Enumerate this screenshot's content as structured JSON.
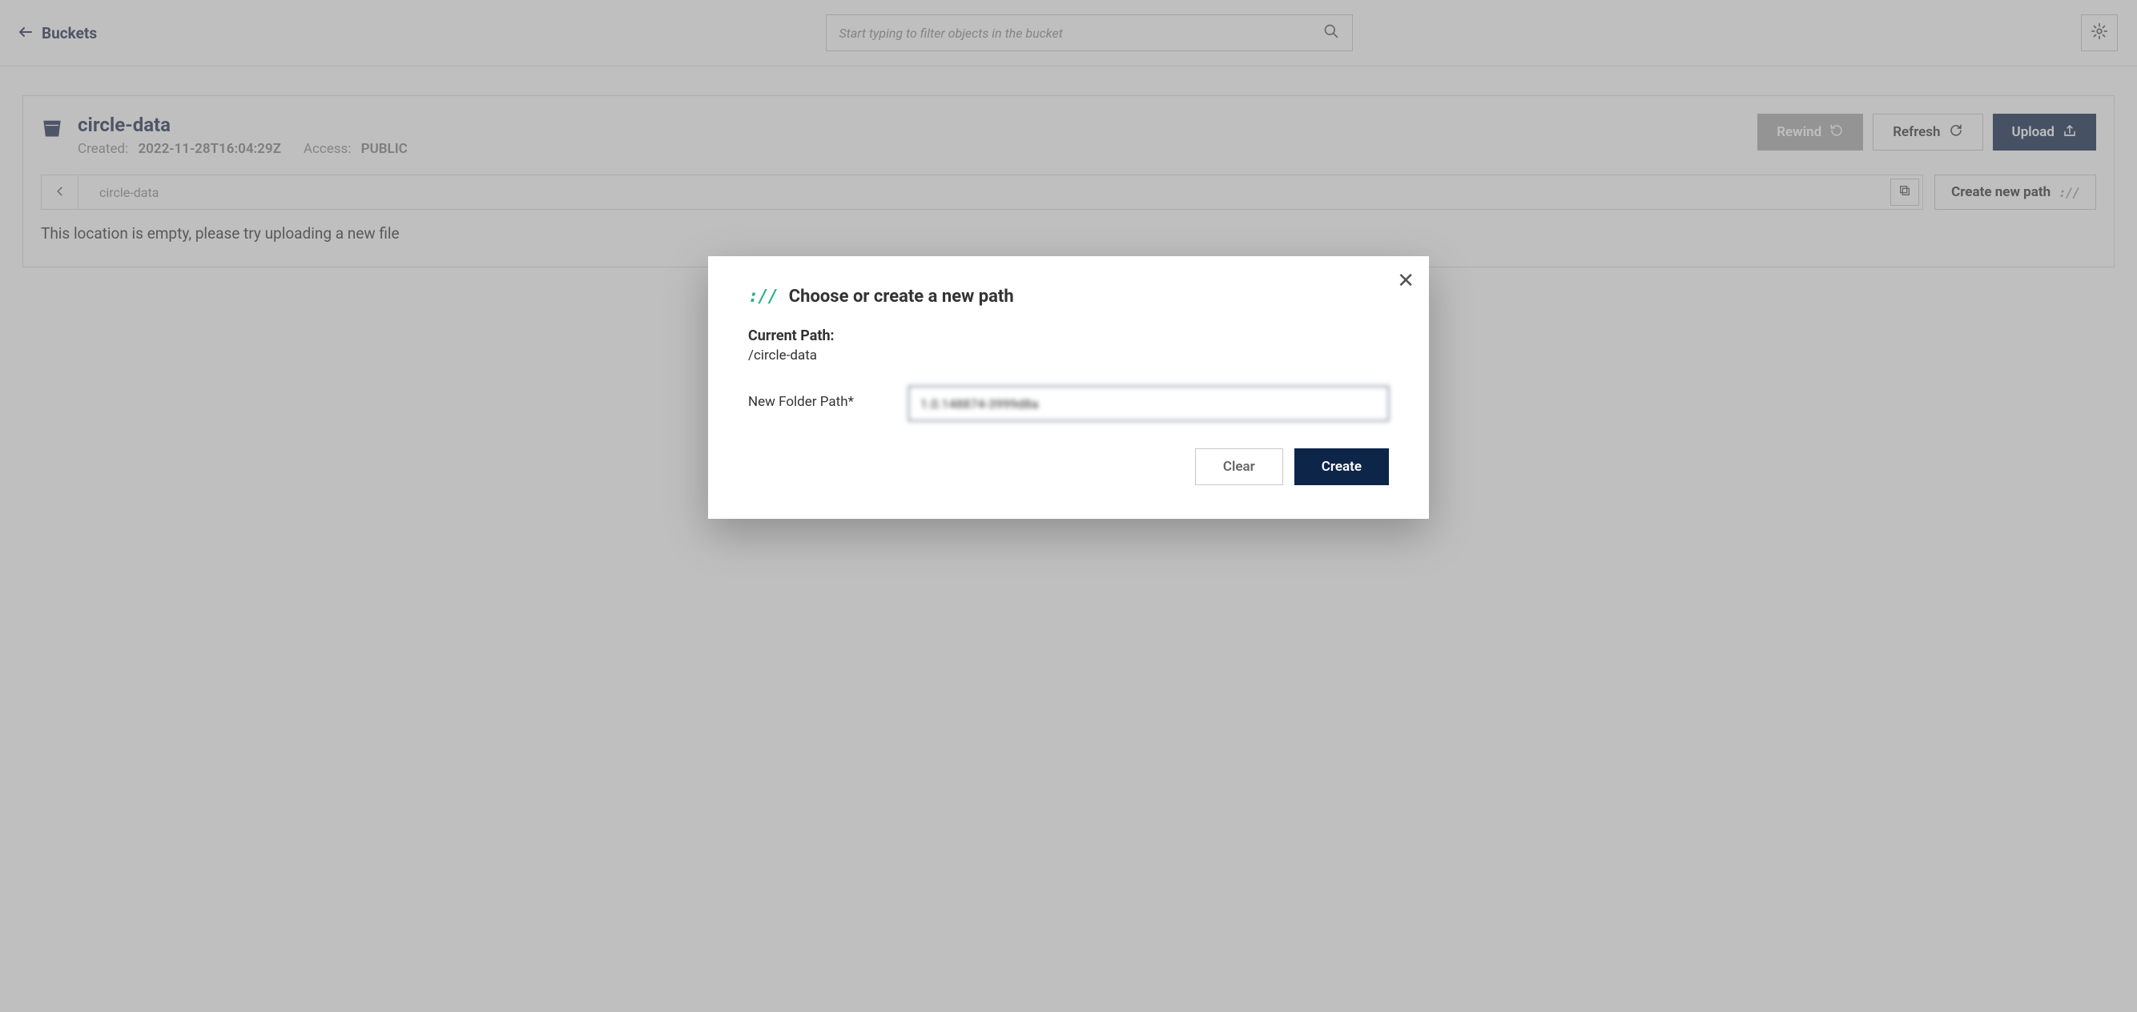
{
  "topbar": {
    "back_label": "Buckets",
    "search_placeholder": "Start typing to filter objects in the bucket"
  },
  "bucket": {
    "name": "circle-data",
    "created_label": "Created:",
    "created_value": "2022-11-28T16:04:29Z",
    "access_label": "Access:",
    "access_value": "PUBLIC"
  },
  "actions": {
    "rewind": "Rewind",
    "refresh": "Refresh",
    "upload": "Upload",
    "create_path": "Create new path"
  },
  "breadcrumb": {
    "current": "circle-data"
  },
  "empty_message": "This location is empty, please try uploading a new file",
  "modal": {
    "title": "Choose or create a new path",
    "current_path_label": "Current Path:",
    "current_path_value": "/circle-data",
    "field_label": "New Folder Path*",
    "input_value": "1.0.148874-3999d8a",
    "clear": "Clear",
    "create": "Create"
  }
}
